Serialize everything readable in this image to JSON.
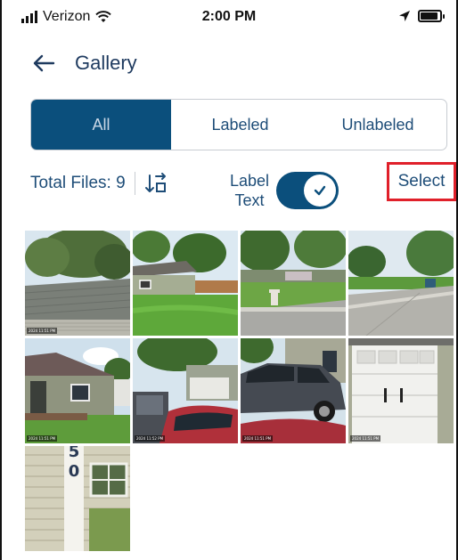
{
  "status_bar": {
    "carrier": "Verizon",
    "time": "2:00 PM"
  },
  "header": {
    "title": "Gallery"
  },
  "tabs": [
    {
      "label": "All",
      "active": true
    },
    {
      "label": "Labeled",
      "active": false
    },
    {
      "label": "Unlabeled",
      "active": false
    }
  ],
  "toolbar": {
    "total_files": "Total Files: 9",
    "label_text_line1": "Label",
    "label_text_line2": "Text",
    "label_text_toggle_on": true,
    "select_label": "Select"
  },
  "photos": [
    {
      "stamp": "2024 11:51 PM",
      "subject": "roof"
    },
    {
      "stamp": "",
      "subject": "house-lawn"
    },
    {
      "stamp": "",
      "subject": "street-hydrant"
    },
    {
      "stamp": "",
      "subject": "street-curb"
    },
    {
      "stamp": "2024 11:51 PM",
      "subject": "house-front"
    },
    {
      "stamp": "2024 11:52 PM",
      "subject": "cars-driveway"
    },
    {
      "stamp": "2024 11:51 PM",
      "subject": "car-side"
    },
    {
      "stamp": "2024 11:51 PM",
      "subject": "garage-door"
    },
    {
      "stamp": "",
      "subject": "house-number"
    }
  ],
  "colors": {
    "primary": "#0b4f7c",
    "text": "#1e4d78",
    "highlight": "#e0202a"
  }
}
